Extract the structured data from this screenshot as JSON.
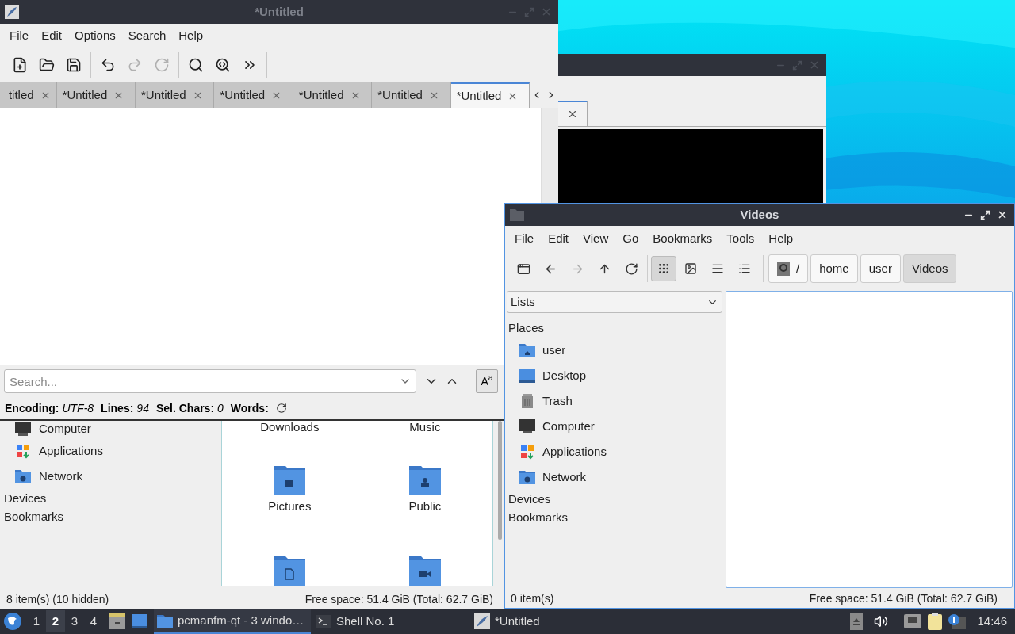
{
  "editor": {
    "title": "*Untitled",
    "menu": [
      "File",
      "Edit",
      "Options",
      "Search",
      "Help"
    ],
    "toolbar": [
      {
        "disabled": false
      },
      {
        "disabled": false
      },
      {
        "disabled": false
      },
      {
        "disabled": false
      },
      {
        "disabled": true
      },
      {
        "disabled": true
      },
      {
        "disabled": false
      },
      {
        "disabled": false
      },
      {
        "disabled": false
      }
    ],
    "tabs": [
      {
        "label": "titled",
        "selected": false
      },
      {
        "label": "*Untitled",
        "selected": false
      },
      {
        "label": "*Untitled",
        "selected": false
      },
      {
        "label": "*Untitled",
        "selected": false
      },
      {
        "label": "*Untitled",
        "selected": false
      },
      {
        "label": "*Untitled",
        "selected": false
      },
      {
        "label": "*Untitled",
        "selected": true
      }
    ],
    "search": {
      "placeholder": "Search...",
      "match_case": "A$^{a}$"
    },
    "status": [
      {
        "label": "Encoding:",
        "value": "UTF-8"
      },
      {
        "label": "Lines:",
        "value": "94"
      },
      {
        "label": "Sel. Chars:",
        "value": "0"
      },
      {
        "label": "Words:"
      }
    ]
  },
  "back_file_manager": {
    "places": [
      {
        "label": "Computer",
        "kind": "computer"
      },
      {
        "label": "Applications",
        "kind": "applications"
      },
      {
        "label": "Network",
        "kind": "network"
      }
    ],
    "sections": [
      "Devices",
      "Bookmarks"
    ],
    "files": [
      {
        "name": "Downloads",
        "kind": "hidden-icon"
      },
      {
        "name": "Music",
        "kind": "hidden-icon"
      },
      {
        "name": "Pictures",
        "kind": "pictures"
      },
      {
        "name": "Public",
        "kind": "public"
      },
      {
        "kind": "documents"
      },
      {
        "kind": "videos"
      }
    ],
    "status_left": "8 item(s) (10 hidden)",
    "status_right": "Free space: 51.4 GiB (Total: 62.7 GiB)"
  },
  "videos_window": {
    "title": "Videos",
    "menu": [
      "File",
      "Edit",
      "View",
      "Go",
      "Bookmarks",
      "Tools",
      "Help"
    ],
    "nav": [
      {
        "disabled": false
      },
      {
        "disabled": false
      },
      {
        "disabled": true
      },
      {
        "disabled": false
      },
      {
        "disabled": false
      }
    ],
    "views": [
      {
        "selected": true
      },
      {
        "selected": false
      },
      {
        "selected": false
      },
      {
        "selected": false
      }
    ],
    "path": [
      {
        "label": "/",
        "kind": "root",
        "selected": false
      },
      {
        "label": "home",
        "kind": "dir",
        "selected": false
      },
      {
        "label": "user",
        "kind": "dir",
        "selected": false
      },
      {
        "label": "Videos",
        "kind": "dir",
        "selected": true
      }
    ],
    "side_mode": "Lists",
    "places_heading": "Places",
    "places": [
      {
        "label": "user",
        "kind": "home"
      },
      {
        "label": "Desktop",
        "kind": "desktop"
      },
      {
        "label": "Trash",
        "kind": "trash"
      },
      {
        "label": "Computer",
        "kind": "computer"
      },
      {
        "label": "Applications",
        "kind": "applications"
      },
      {
        "label": "Network",
        "kind": "network"
      }
    ],
    "sections": [
      "Devices",
      "Bookmarks"
    ],
    "status_left": "0 item(s)",
    "status_right": "Free space: 51.4 GiB (Total: 62.7 GiB)"
  },
  "taskbar": {
    "workspaces": [
      {
        "label": "1",
        "selected": false
      },
      {
        "label": "2",
        "selected": true
      },
      {
        "label": "3",
        "selected": false
      },
      {
        "label": "4",
        "selected": false
      }
    ],
    "tasks": [
      {
        "label": "pcmanfm-qt - 3 windo…",
        "kind": "folder",
        "selected": true
      },
      {
        "label": "Shell No. 1",
        "kind": "terminal",
        "selected": false
      },
      {
        "label": "*Untitled",
        "kind": "editor",
        "selected": false
      }
    ],
    "clock": "14:46"
  }
}
